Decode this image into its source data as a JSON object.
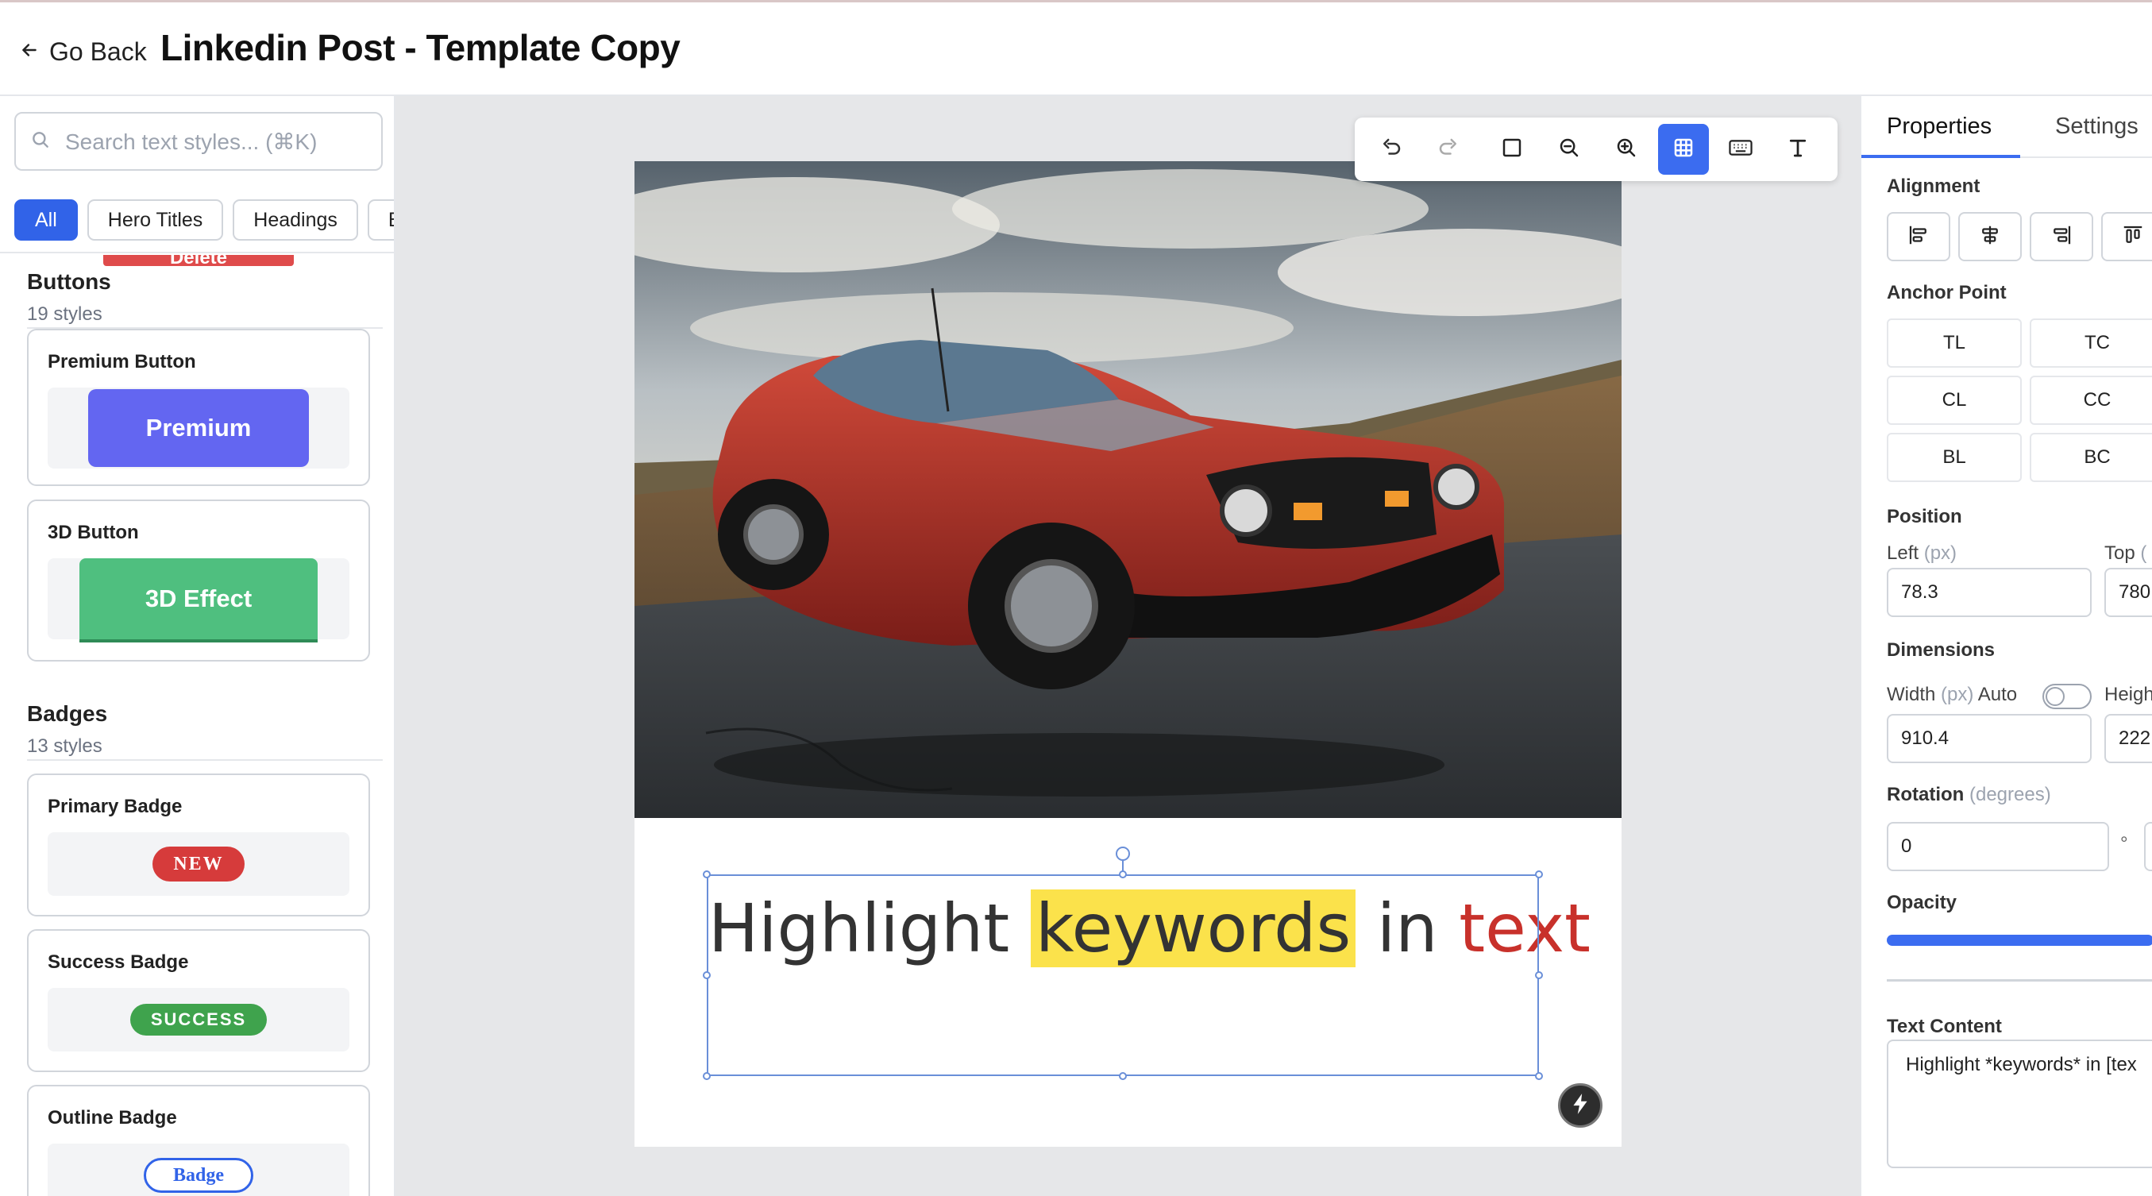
{
  "header": {
    "back_label": "Go Back",
    "title": "Linkedin Post - Template Copy"
  },
  "left_panel": {
    "search_placeholder": "Search text styles... (⌘K)",
    "chips": [
      "All",
      "Hero Titles",
      "Headings",
      "B"
    ],
    "active_chip": "All",
    "clipped_item_label": "Delete",
    "groups": [
      {
        "title": "Buttons",
        "count": "19 styles",
        "items": [
          {
            "name": "Premium Button",
            "preview": "Premium"
          },
          {
            "name": "3D Button",
            "preview": "3D Effect"
          }
        ]
      },
      {
        "title": "Badges",
        "count": "13 styles",
        "items": [
          {
            "name": "Primary Badge",
            "preview": "NEW"
          },
          {
            "name": "Success Badge",
            "preview": "SUCCESS"
          },
          {
            "name": "Outline Badge",
            "preview": "Badge"
          }
        ]
      }
    ]
  },
  "toolbar": {
    "buttons": [
      "undo-icon",
      "redo-icon",
      "frame-icon",
      "zoom-out-icon",
      "zoom-in-icon",
      "grid-icon",
      "keyboard-icon",
      "text-icon"
    ],
    "active": "grid-icon"
  },
  "canvas": {
    "text_parts": {
      "before": "Highlight ",
      "highlight": "keywords",
      "middle": " in ",
      "colored": "text"
    },
    "colors": {
      "highlight": "#fbe24b",
      "colored_text": "#c8312b",
      "selection": "#6a8fd8"
    }
  },
  "right_panel": {
    "tabs": [
      "Properties",
      "Settings"
    ],
    "active_tab": "Properties",
    "alignment_label": "Alignment",
    "alignment_icons": [
      "align-left-icon",
      "align-center-icon",
      "align-right-icon",
      "align-top-icon"
    ],
    "anchor_label": "Anchor Point",
    "anchors": [
      "TL",
      "TC",
      "CL",
      "CC",
      "BL",
      "BC"
    ],
    "position_label": "Position",
    "left_label": "Left",
    "left_unit": "(px)",
    "left_value": "78.3",
    "top_label": "Top",
    "top_unit": "(",
    "top_value": "780",
    "dimensions_label": "Dimensions",
    "width_label": "Width",
    "width_unit": "(px)",
    "auto_label": "Auto",
    "width_value": "910.4",
    "height_label": "Heigh",
    "height_value": "222",
    "rotation_label": "Rotation",
    "rotation_unit": "(degrees)",
    "rotation_value": "0",
    "degree_symbol": "°",
    "opacity_label": "Opacity",
    "text_content_label": "Text Content",
    "text_content_value": "Highlight *keywords* in [tex"
  }
}
